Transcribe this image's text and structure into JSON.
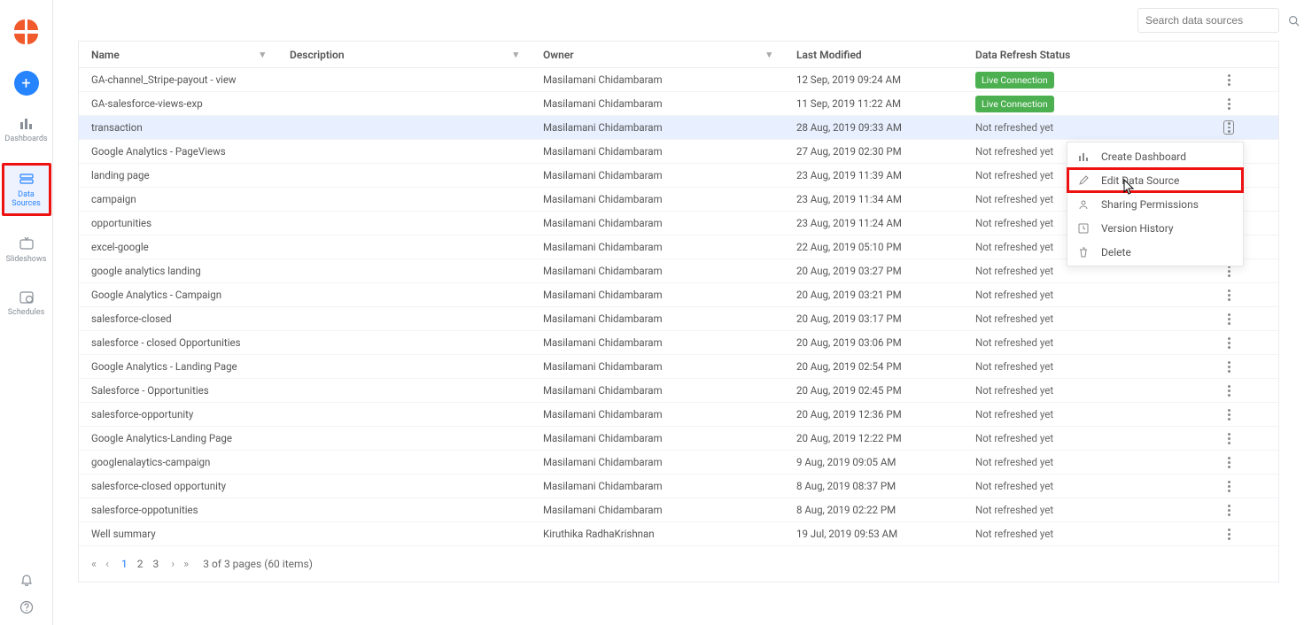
{
  "search": {
    "placeholder": "Search data sources"
  },
  "sidebar": {
    "items": [
      {
        "label": "Dashboards"
      },
      {
        "label": "Data Sources"
      },
      {
        "label": "Slideshows"
      },
      {
        "label": "Schedules"
      }
    ]
  },
  "columns": {
    "name": "Name",
    "description": "Description",
    "owner": "Owner",
    "modified": "Last Modified",
    "status": "Data Refresh Status"
  },
  "status_live": "Live Connection",
  "status_not": "Not refreshed yet",
  "rows": [
    {
      "name": "GA-channel_Stripe-payout - view",
      "owner": "Masilamani Chidambaram",
      "modified": "12 Sep, 2019 09:24 AM",
      "live": true
    },
    {
      "name": "GA-salesforce-views-exp",
      "owner": "Masilamani Chidambaram",
      "modified": "11 Sep, 2019 11:22 AM",
      "live": true
    },
    {
      "name": "transaction",
      "owner": "Masilamani Chidambaram",
      "modified": "28 Aug, 2019 09:33 AM",
      "live": false,
      "selected": true,
      "menuOpen": true
    },
    {
      "name": "Google Analytics - PageViews",
      "owner": "Masilamani Chidambaram",
      "modified": "27 Aug, 2019 02:30 PM",
      "live": false
    },
    {
      "name": "landing page",
      "owner": "Masilamani Chidambaram",
      "modified": "23 Aug, 2019 11:39 AM",
      "live": false
    },
    {
      "name": "campaign",
      "owner": "Masilamani Chidambaram",
      "modified": "23 Aug, 2019 11:34 AM",
      "live": false
    },
    {
      "name": "opportunities",
      "owner": "Masilamani Chidambaram",
      "modified": "23 Aug, 2019 11:24 AM",
      "live": false
    },
    {
      "name": "excel-google",
      "owner": "Masilamani Chidambaram",
      "modified": "22 Aug, 2019 05:10 PM",
      "live": false
    },
    {
      "name": "google analytics landing",
      "owner": "Masilamani Chidambaram",
      "modified": "20 Aug, 2019 03:27 PM",
      "live": false
    },
    {
      "name": "Google Analytics - Campaign",
      "owner": "Masilamani Chidambaram",
      "modified": "20 Aug, 2019 03:21 PM",
      "live": false
    },
    {
      "name": "salesforce-closed",
      "owner": "Masilamani Chidambaram",
      "modified": "20 Aug, 2019 03:17 PM",
      "live": false
    },
    {
      "name": "salesforce - closed Opportunities",
      "owner": "Masilamani Chidambaram",
      "modified": "20 Aug, 2019 03:06 PM",
      "live": false
    },
    {
      "name": "Google Analytics - Landing Page",
      "owner": "Masilamani Chidambaram",
      "modified": "20 Aug, 2019 02:54 PM",
      "live": false
    },
    {
      "name": "Salesforce - Opportunities",
      "owner": "Masilamani Chidambaram",
      "modified": "20 Aug, 2019 02:45 PM",
      "live": false
    },
    {
      "name": "salesforce-opportunity",
      "owner": "Masilamani Chidambaram",
      "modified": "20 Aug, 2019 12:36 PM",
      "live": false
    },
    {
      "name": "Google Analytics-Landing Page",
      "owner": "Masilamani Chidambaram",
      "modified": "20 Aug, 2019 12:22 PM",
      "live": false
    },
    {
      "name": "googlenalaytics-campaign",
      "owner": "Masilamani Chidambaram",
      "modified": "9 Aug, 2019 09:05 AM",
      "live": false
    },
    {
      "name": "salesforce-closed opportunity",
      "owner": "Masilamani Chidambaram",
      "modified": "8 Aug, 2019 08:37 PM",
      "live": false
    },
    {
      "name": "salesforce-oppotunities",
      "owner": "Masilamani Chidambaram",
      "modified": "8 Aug, 2019 02:22 PM",
      "live": false
    },
    {
      "name": "Well summary",
      "owner": "Kiruthika RadhaKrishnan",
      "modified": "19 Jul, 2019 09:53 AM",
      "live": false
    }
  ],
  "pagination": {
    "pages": [
      "1",
      "2",
      "3"
    ],
    "current": "1",
    "info": "3 of 3 pages (60 items)"
  },
  "ctx": {
    "create": "Create Dashboard",
    "edit": "Edit Data Source",
    "share": "Sharing Permissions",
    "version": "Version History",
    "delete": "Delete"
  }
}
